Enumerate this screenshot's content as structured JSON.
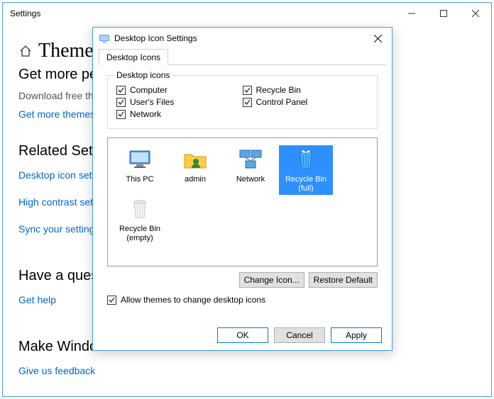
{
  "settings": {
    "windowTitle": "Settings",
    "heading": "Themes",
    "cutHeader": "Get more personalization",
    "subText": "Download free themes from the store with backgrounds, sounds, and colors",
    "moreLink": "Get more themes",
    "relatedHeading": "Related Settings",
    "related": {
      "desktopIcon": "Desktop icon settings",
      "highContrast": "High contrast settings",
      "sync": "Sync your settings"
    },
    "questionHeading": "Have a question?",
    "helpLink": "Get help",
    "betterHeading": "Make Windows better",
    "feedbackLink": "Give us feedback"
  },
  "dialog": {
    "title": "Desktop Icon Settings",
    "tab": "Desktop Icons",
    "groupLegend": "Desktop icons",
    "checks": {
      "computer": "Computer",
      "usersFiles": "User's Files",
      "network": "Network",
      "recycleBin": "Recycle Bin",
      "controlPanel": "Control Panel"
    },
    "icons": {
      "thisPc": "This PC",
      "admin": "admin",
      "network": "Network",
      "recycleFull": "Recycle Bin (full)",
      "recycleEmpty": "Recycle Bin (empty)"
    },
    "selectedIcon": "recycleFull",
    "changeIcon": "Change Icon...",
    "restoreDefault": "Restore Default",
    "allowThemes": "Allow themes to change desktop icons",
    "allowThemesChecked": true,
    "btnOk": "OK",
    "btnCancel": "Cancel",
    "btnApply": "Apply"
  }
}
